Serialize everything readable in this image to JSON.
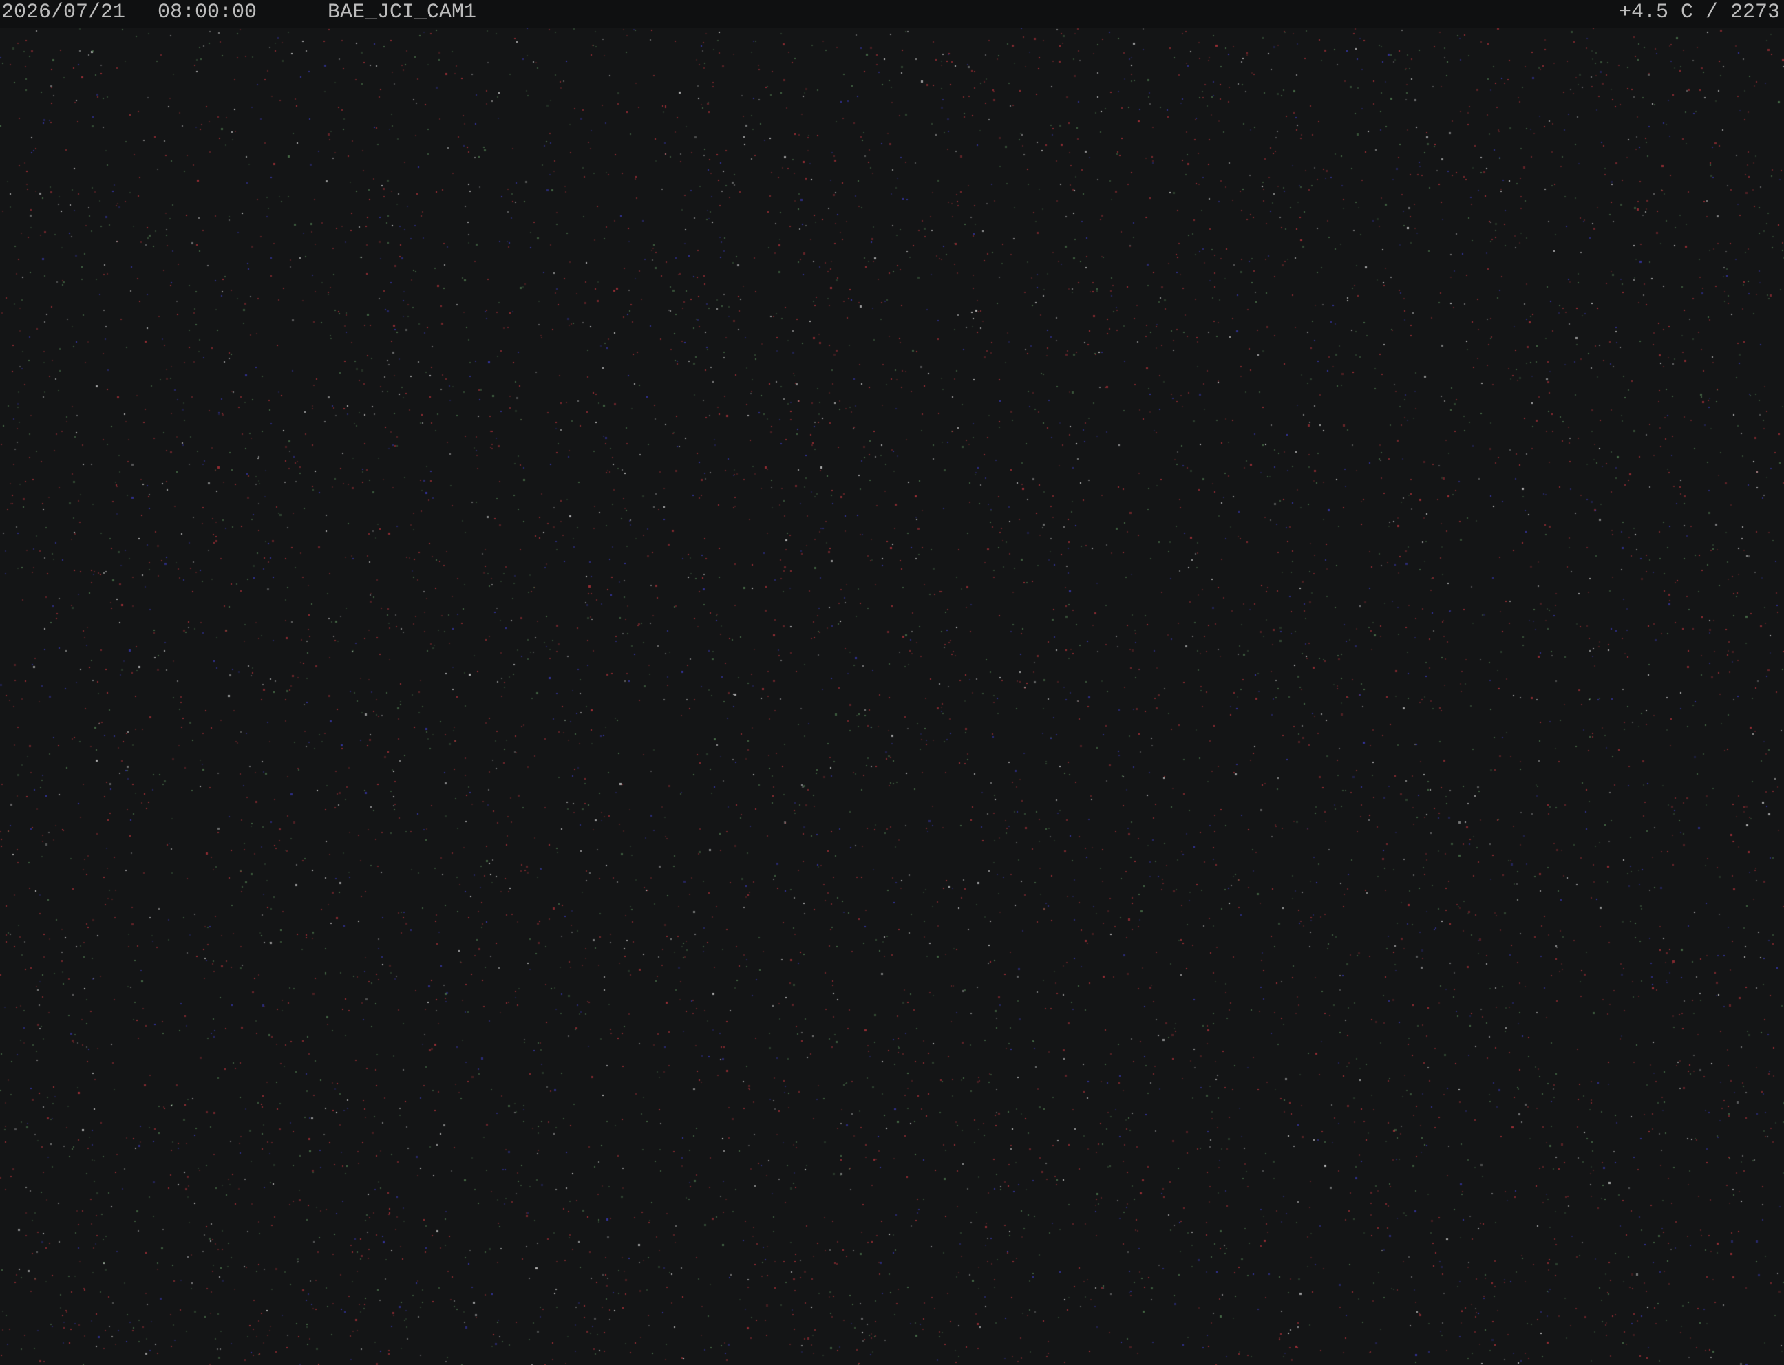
{
  "overlay": {
    "date": "2026/07/21",
    "time": "08:00:00",
    "camera_id": "BAE_JCI_CAM1",
    "readout": "+4.5 C / 2273"
  },
  "colors": {
    "background": "#141516",
    "overlay_bar": "#0f1011",
    "overlay_text": "#bdbdbd",
    "noise_red": "#b3323a",
    "noise_blue": "#3a3ab8",
    "noise_green": "#4f7a4f",
    "noise_white": "#d8d8d8"
  }
}
